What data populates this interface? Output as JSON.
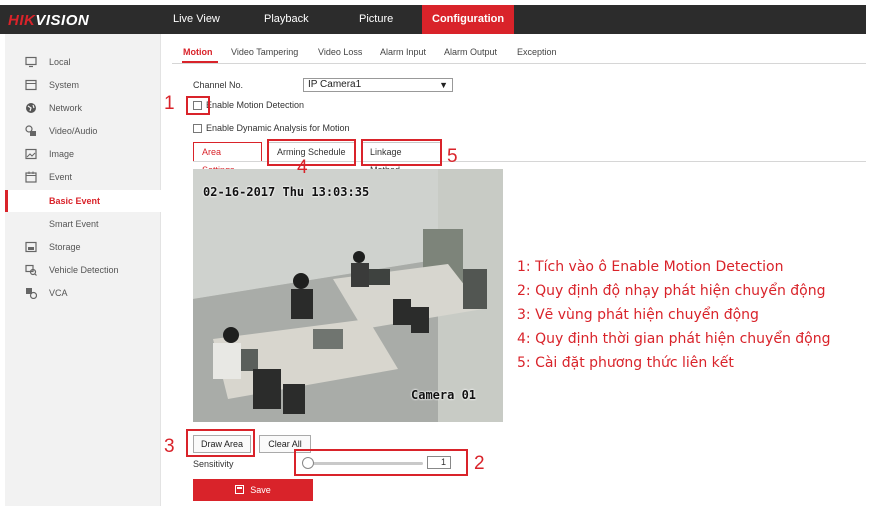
{
  "app": {
    "logo_prefix": "HIK",
    "logo_suffix": "VISION"
  },
  "topnav": [
    {
      "label": "Live View"
    },
    {
      "label": "Playback"
    },
    {
      "label": "Picture"
    },
    {
      "label": "Configuration",
      "active": true
    }
  ],
  "sidebar": {
    "items": [
      {
        "label": "Local",
        "icon": "monitor-icon"
      },
      {
        "label": "System",
        "icon": "system-icon"
      },
      {
        "label": "Network",
        "icon": "globe-icon"
      },
      {
        "label": "Video/Audio",
        "icon": "video-audio-icon"
      },
      {
        "label": "Image",
        "icon": "image-icon"
      },
      {
        "label": "Event",
        "icon": "calendar-icon"
      },
      {
        "label": "Basic Event",
        "active": true
      },
      {
        "label": "Smart Event"
      },
      {
        "label": "Storage",
        "icon": "storage-icon"
      },
      {
        "label": "Vehicle Detection",
        "icon": "vehicle-detection-icon"
      },
      {
        "label": "VCA",
        "icon": "vca-icon"
      }
    ]
  },
  "tabs": [
    {
      "label": "Motion",
      "active": true
    },
    {
      "label": "Video Tampering"
    },
    {
      "label": "Video Loss"
    },
    {
      "label": "Alarm Input"
    },
    {
      "label": "Alarm Output"
    },
    {
      "label": "Exception"
    }
  ],
  "form": {
    "channel_label": "Channel No.",
    "channel_value": "IP Camera1",
    "enable_motion_label": "Enable Motion Detection",
    "enable_dynamic_label": "Enable Dynamic Analysis for Motion",
    "enable_motion_checked": false,
    "enable_dynamic_checked": false
  },
  "subtabs": [
    {
      "label": "Area Settings",
      "active": true
    },
    {
      "label": "Arming Schedule"
    },
    {
      "label": "Linkage Method"
    }
  ],
  "video": {
    "timestamp": "02-16-2017 Thu 13:03:35",
    "camera_name": "Camera 01"
  },
  "buttons": {
    "draw_area": "Draw Area",
    "clear_all": "Clear All",
    "save": "Save"
  },
  "sensitivity": {
    "label": "Sensitivity",
    "value": "1",
    "level": 0.0
  },
  "annotations": {
    "numbers": [
      "1",
      "2",
      "3",
      "4",
      "5"
    ],
    "notes": [
      "1: Tích vào ô Enable Motion Detection",
      "2: Quy định độ nhạy phát hiện chuyển động",
      "3: Vẽ vùng phát hiện chuyển động",
      "4: Quy định thời gian phát hiện chuyển động",
      "5: Cài đặt phương thức liên kết"
    ],
    "color": "#d9232a"
  },
  "colors": {
    "accent": "#d9232a",
    "topbar": "#2c2c2c",
    "sidebar": "#f2f2f2"
  }
}
